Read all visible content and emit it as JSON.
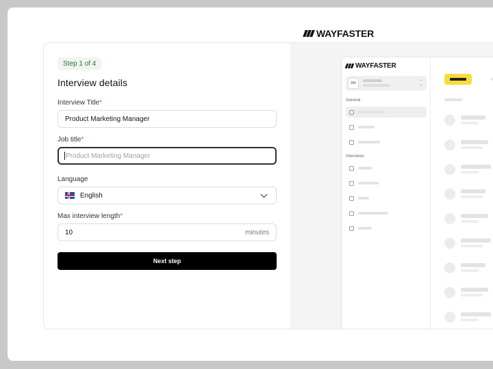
{
  "brand": {
    "name": "WAYFASTER"
  },
  "form": {
    "step": "Step 1 of 4",
    "title": "Interview details",
    "interview_title": {
      "label": "Interview Title",
      "required_mark": "*",
      "value": "Product Marketing Manager"
    },
    "job_title": {
      "label": "Job title",
      "required_mark": "*",
      "placeholder": "Product Marketing Manager",
      "value": ""
    },
    "language": {
      "label": "Language",
      "value": "English",
      "flag": "iceland-flag"
    },
    "max_length": {
      "label": "Max interview length",
      "required_mark": "*",
      "value": "10",
      "suffix": "minutes"
    },
    "next_button": "Next step"
  },
  "preview": {
    "brand": "WAYFASTER",
    "avatar_initials": "DH",
    "sections": [
      "General",
      "Interviews"
    ],
    "accent_color": "#f7dc3b"
  },
  "colors": {
    "required": "#e5484d",
    "primary_button": "#000000",
    "step_badge_bg": "#eef6ef"
  }
}
